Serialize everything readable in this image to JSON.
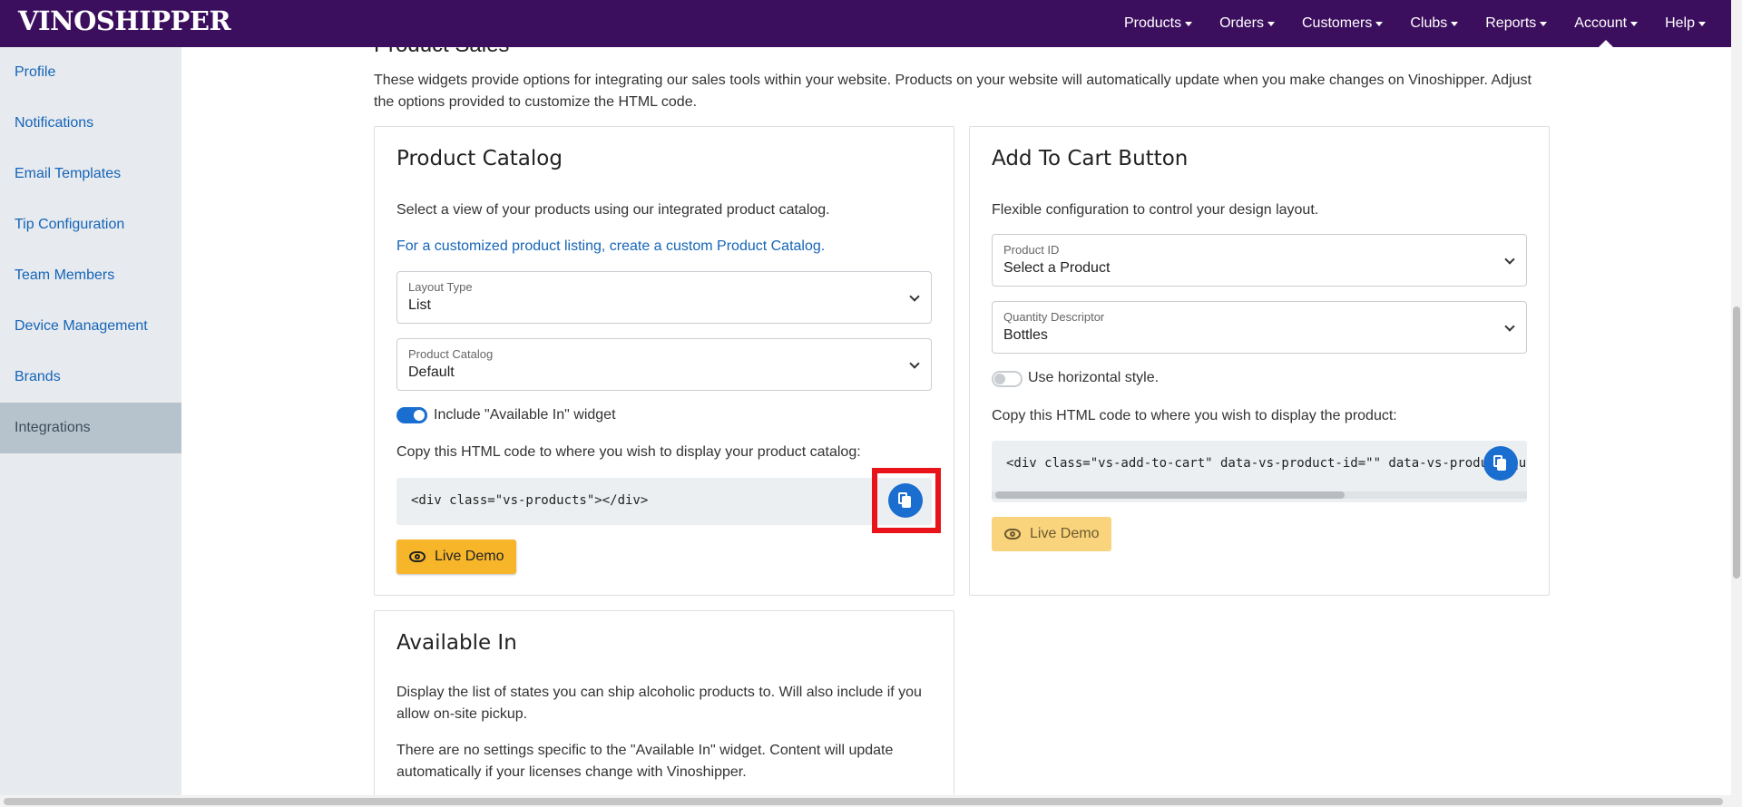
{
  "app": {
    "logo_text": "VINOSHIPPER"
  },
  "nav": {
    "items": [
      {
        "label": "Products"
      },
      {
        "label": "Orders"
      },
      {
        "label": "Customers"
      },
      {
        "label": "Clubs"
      },
      {
        "label": "Reports"
      },
      {
        "label": "Account",
        "active": true
      },
      {
        "label": "Help"
      }
    ]
  },
  "sidebar": {
    "items": [
      {
        "label": "Profile"
      },
      {
        "label": "Notifications"
      },
      {
        "label": "Email Templates"
      },
      {
        "label": "Tip Configuration"
      },
      {
        "label": "Team Members"
      },
      {
        "label": "Device Management"
      },
      {
        "label": "Brands"
      },
      {
        "label": "Integrations",
        "active": true
      }
    ]
  },
  "page": {
    "section_title": "Product Sales",
    "intro": "These widgets provide options for integrating our sales tools within your website. Products on your website will automatically update when you make changes on Vinoshipper. Adjust the options provided to customize the HTML code."
  },
  "catalog_card": {
    "title": "Product Catalog",
    "description": "Select a view of your products using our integrated product catalog.",
    "custom_link": "For a customized product listing, create a custom Product Catalog.",
    "layout_type": {
      "label": "Layout Type",
      "value": "List"
    },
    "product_catalog": {
      "label": "Product Catalog",
      "value": "Default"
    },
    "available_in_toggle": {
      "label": "Include \"Available In\" widget",
      "checked": true
    },
    "copy_instructions": "Copy this HTML code to where you wish to display your product catalog:",
    "code": "<div class=\"vs-products\"></div>",
    "live_demo_label": "Live Demo"
  },
  "cart_card": {
    "title": "Add To Cart Button",
    "description": "Flexible configuration to control your design layout.",
    "product_id": {
      "label": "Product ID",
      "value": "Select a Product"
    },
    "quantity_descriptor": {
      "label": "Quantity Descriptor",
      "value": "Bottles"
    },
    "horizontal_toggle": {
      "label": "Use horizontal style.",
      "checked": false
    },
    "copy_instructions": "Copy this HTML code to where you wish to display the product:",
    "code": "<div class=\"vs-add-to-cart\" data-vs-product-id=\"\" data-vs-product-quantity-descriptor=\"Bottles\"></div>",
    "live_demo_label": "Live Demo"
  },
  "available_card": {
    "title": "Available In",
    "description": "Display the list of states you can ship alcoholic products to. Will also include if you allow on-site pickup.",
    "note": "There are no settings specific to the \"Available In\" widget. Content will update automatically if your licenses change with Vinoshipper."
  },
  "colors": {
    "nav_bg": "#3c0f5e",
    "link": "#1565b8",
    "primary": "#1a6ed0",
    "accent": "#f7b62a",
    "highlight": "#e8141a"
  }
}
